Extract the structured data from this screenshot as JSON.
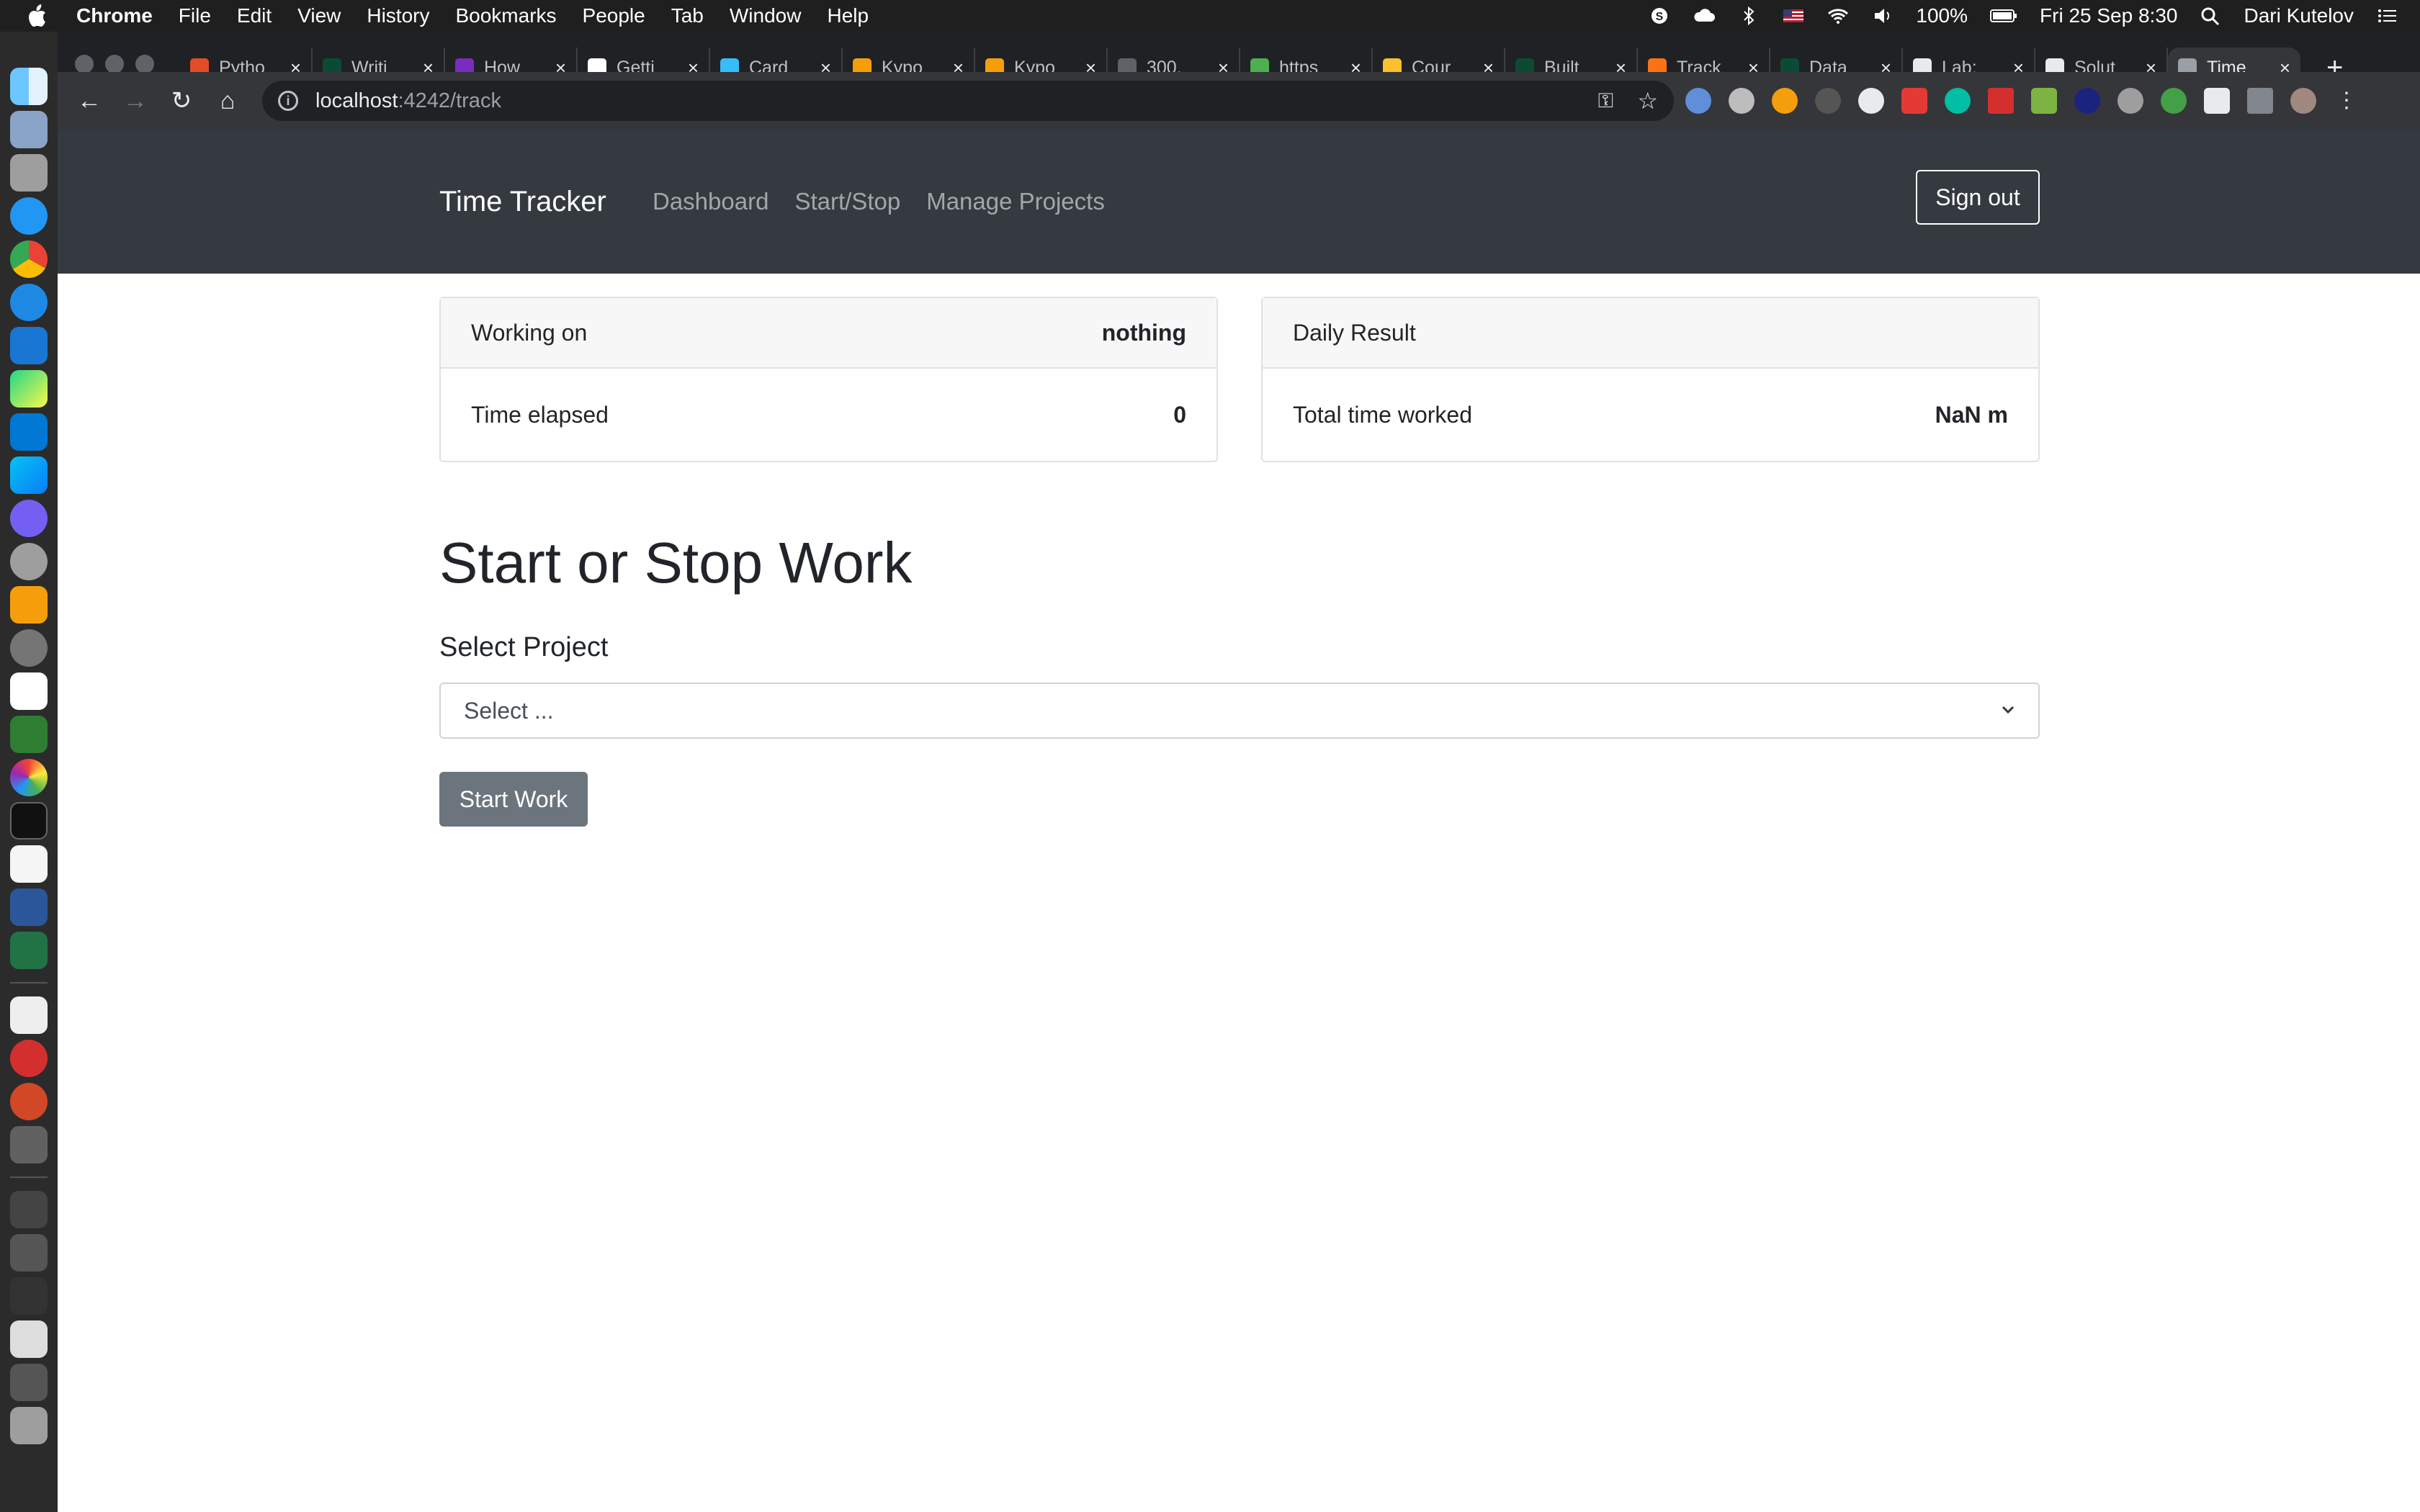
{
  "menubar": {
    "app": "Chrome",
    "items": [
      "File",
      "Edit",
      "View",
      "History",
      "Bookmarks",
      "People",
      "Tab",
      "Window",
      "Help"
    ],
    "battery": "100%",
    "datetime": "Fri 25 Sep  8:30",
    "user": "Dari Kutelov"
  },
  "tabs": [
    {
      "title": "Pytho",
      "fav_color": "#e34c26"
    },
    {
      "title": "Writi",
      "fav_color": "#0c4b33"
    },
    {
      "title": "How",
      "fav_color": "#7b2cbf"
    },
    {
      "title": "Getti",
      "fav_color": "#ffffff"
    },
    {
      "title": "Card",
      "fav_color": "#38bdf8"
    },
    {
      "title": "Kypo",
      "fav_color": "#f59e0b"
    },
    {
      "title": "Kypo",
      "fav_color": "#f59e0b"
    },
    {
      "title": "300.",
      "fav_color": "#5f6368"
    },
    {
      "title": "https",
      "fav_color": "#4caf50"
    },
    {
      "title": "Cour",
      "fav_color": "#fbc02d"
    },
    {
      "title": "Built",
      "fav_color": "#0c4b33"
    },
    {
      "title": "Track",
      "fav_color": "#f97316"
    },
    {
      "title": "Data",
      "fav_color": "#0c4b33"
    },
    {
      "title": "Lab:",
      "fav_color": "#e8eaed"
    },
    {
      "title": "Solut",
      "fav_color": "#e8eaed"
    },
    {
      "title": "Time",
      "fav_color": "#9aa0a6",
      "active": true
    }
  ],
  "address": {
    "host": "localhost",
    "path": ":4242/track"
  },
  "app": {
    "brand": "Time Tracker",
    "nav": [
      "Dashboard",
      "Start/Stop",
      "Manage Projects"
    ],
    "signout": "Sign out"
  },
  "status_card": {
    "header_label": "Working on",
    "header_value": "nothing",
    "body_label": "Time elapsed",
    "body_value": "0"
  },
  "daily_card": {
    "header_label": "Daily Result",
    "body_label": "Total time worked",
    "body_value": "NaN m"
  },
  "form": {
    "heading": "Start or Stop Work",
    "select_label": "Select Project",
    "select_value": "Select ...",
    "button": "Start Work"
  }
}
